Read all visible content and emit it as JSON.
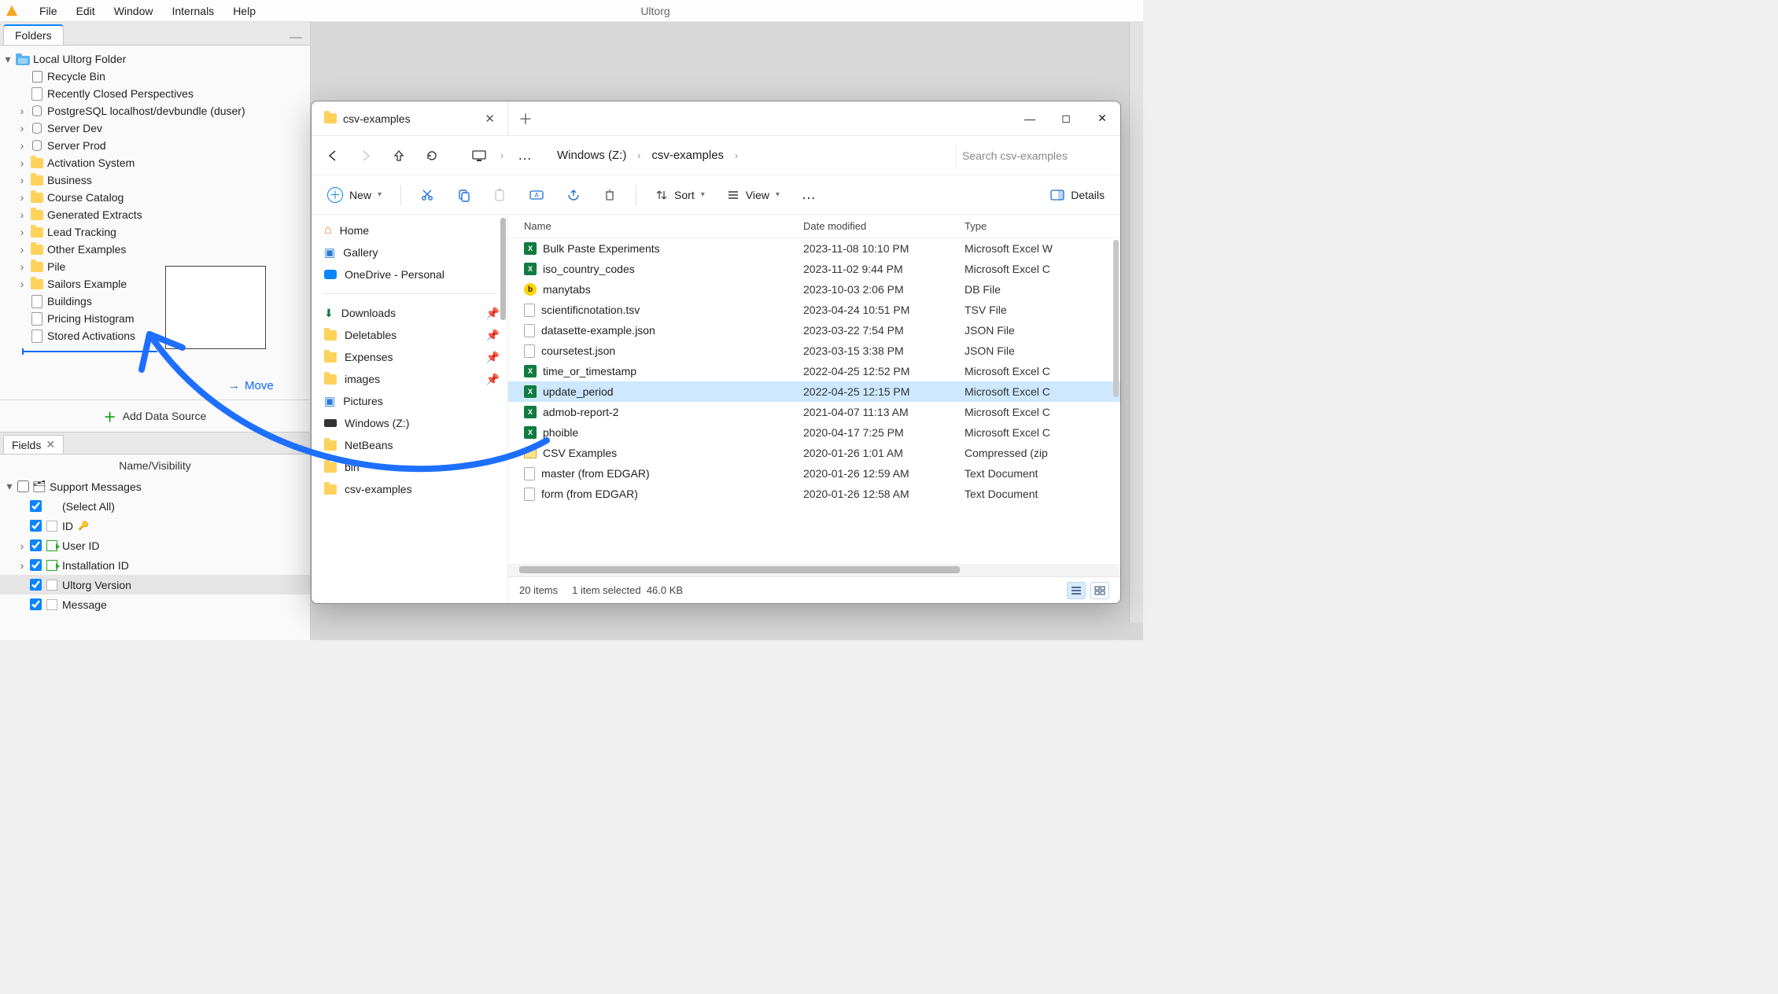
{
  "app": {
    "title": "Ultorg",
    "menus": [
      "File",
      "Edit",
      "Window",
      "Internals",
      "Help"
    ]
  },
  "sidebar": {
    "tab": "Folders",
    "root": "Local Ultorg Folder",
    "items": [
      {
        "icon": "trash",
        "label": "Recycle Bin"
      },
      {
        "icon": "doc",
        "label": "Recently Closed Perspectives"
      },
      {
        "icon": "db",
        "label": "PostgreSQL localhost/devbundle (duser)"
      },
      {
        "icon": "db",
        "label": "Server Dev"
      },
      {
        "icon": "db",
        "label": "Server Prod"
      },
      {
        "icon": "folder",
        "label": "Activation System"
      },
      {
        "icon": "folder",
        "label": "Business"
      },
      {
        "icon": "folder",
        "label": "Course Catalog"
      },
      {
        "icon": "folder",
        "label": "Generated Extracts"
      },
      {
        "icon": "folder",
        "label": "Lead Tracking"
      },
      {
        "icon": "folder",
        "label": "Other Examples"
      },
      {
        "icon": "folder",
        "label": "Pile"
      },
      {
        "icon": "folder",
        "label": "Sailors Example"
      },
      {
        "icon": "doc",
        "label": "Buildings"
      },
      {
        "icon": "doc",
        "label": "Pricing Histogram"
      },
      {
        "icon": "doc",
        "label": "Stored Activations"
      }
    ],
    "drag_hint": "Move",
    "add_source": "Add Data Source"
  },
  "fields": {
    "tab": "Fields",
    "header": "Name/Visibility",
    "group": "Support Messages",
    "rows": [
      {
        "label": "(Select All)",
        "checked": true,
        "icon": "",
        "key": false
      },
      {
        "label": "ID",
        "checked": true,
        "icon": "col",
        "key": true
      },
      {
        "label": "User ID",
        "checked": true,
        "icon": "fk",
        "key": false,
        "expand": true
      },
      {
        "label": "Installation ID",
        "checked": true,
        "icon": "fk",
        "key": false,
        "expand": true
      },
      {
        "label": "Ultorg Version",
        "checked": true,
        "icon": "col",
        "key": false,
        "selected": true
      },
      {
        "label": "Message",
        "checked": true,
        "icon": "col",
        "key": false
      }
    ]
  },
  "explorer": {
    "tab_title": "csv-examples",
    "breadcrumbs": [
      "Windows (Z:)",
      "csv-examples"
    ],
    "search_placeholder": "Search csv-examples",
    "toolbar": {
      "new_label": "New",
      "sort_label": "Sort",
      "view_label": "View",
      "details_label": "Details"
    },
    "nav": [
      {
        "icon": "home",
        "label": "Home"
      },
      {
        "icon": "gallery",
        "label": "Gallery"
      },
      {
        "icon": "onedrive",
        "label": "OneDrive - Personal"
      }
    ],
    "nav2": [
      {
        "icon": "dl",
        "label": "Downloads",
        "pin": true
      },
      {
        "icon": "folder",
        "label": "Deletables",
        "pin": true
      },
      {
        "icon": "folder",
        "label": "Expenses",
        "pin": true
      },
      {
        "icon": "folder",
        "label": "images",
        "pin": true
      },
      {
        "icon": "pictures",
        "label": "Pictures"
      },
      {
        "icon": "drive",
        "label": "Windows (Z:)"
      },
      {
        "icon": "folder",
        "label": "NetBeans"
      },
      {
        "icon": "folder",
        "label": "bin"
      },
      {
        "icon": "folder",
        "label": "csv-examples"
      }
    ],
    "columns": [
      "Name",
      "Date modified",
      "Type"
    ],
    "files": [
      {
        "icon": "xl",
        "name": "Bulk Paste Experiments",
        "date": "2023-11-08 10:10 PM",
        "type": "Microsoft Excel W"
      },
      {
        "icon": "xl",
        "name": "iso_country_codes",
        "date": "2023-11-02 9:44 PM",
        "type": "Microsoft Excel C"
      },
      {
        "icon": "db",
        "name": "manytabs",
        "date": "2023-10-03 2:06 PM",
        "type": "DB File"
      },
      {
        "icon": "txt",
        "name": "scientificnotation.tsv",
        "date": "2023-04-24 10:51 PM",
        "type": "TSV File"
      },
      {
        "icon": "json",
        "name": "datasette-example.json",
        "date": "2023-03-22 7:54 PM",
        "type": "JSON File"
      },
      {
        "icon": "json",
        "name": "coursetest.json",
        "date": "2023-03-15 3:38 PM",
        "type": "JSON File"
      },
      {
        "icon": "xl",
        "name": "time_or_timestamp",
        "date": "2022-04-25 12:52 PM",
        "type": "Microsoft Excel C"
      },
      {
        "icon": "xl",
        "name": "update_period",
        "date": "2022-04-25 12:15 PM",
        "type": "Microsoft Excel C",
        "selected": true
      },
      {
        "icon": "xl",
        "name": "admob-report-2",
        "date": "2021-04-07 11:13 AM",
        "type": "Microsoft Excel C"
      },
      {
        "icon": "xl",
        "name": "phoible",
        "date": "2020-04-17 7:25 PM",
        "type": "Microsoft Excel C"
      },
      {
        "icon": "zip",
        "name": "CSV Examples",
        "date": "2020-01-26 1:01 AM",
        "type": "Compressed (zip"
      },
      {
        "icon": "txt",
        "name": "master (from EDGAR)",
        "date": "2020-01-26 12:59 AM",
        "type": "Text Document"
      },
      {
        "icon": "txt",
        "name": "form (from EDGAR)",
        "date": "2020-01-26 12:58 AM",
        "type": "Text Document"
      }
    ],
    "status": {
      "count": "20 items",
      "selection": "1 item selected",
      "size": "46.0 KB"
    }
  }
}
